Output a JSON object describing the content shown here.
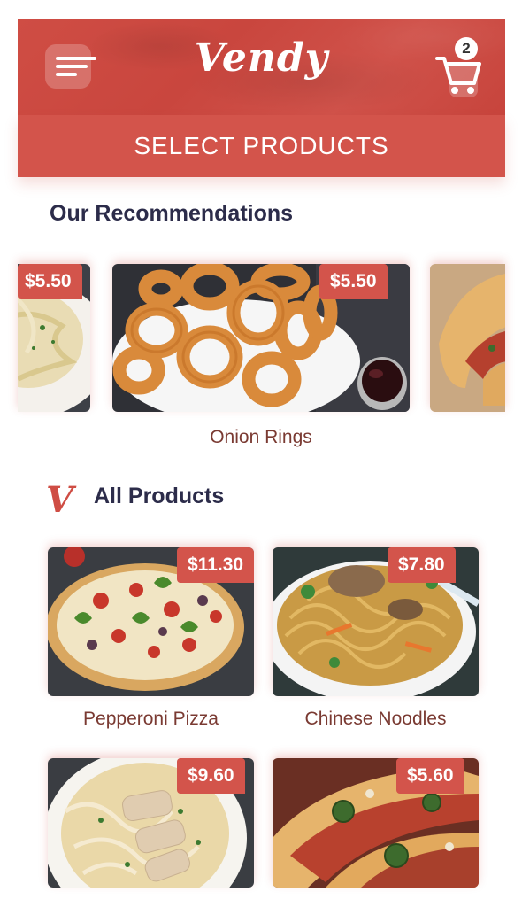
{
  "header": {
    "logo": "Vendy",
    "cart_count": "2",
    "subtitle": "SELECT PRODUCTS"
  },
  "recommendations": {
    "title": "Our Recommendations",
    "items": [
      {
        "name": "",
        "price": "$5.50"
      },
      {
        "name": "Onion Rings",
        "price": "$5.50"
      },
      {
        "name": "",
        "price": ""
      }
    ]
  },
  "all_products": {
    "icon_letter": "V",
    "title": "All Products",
    "items": [
      {
        "name": "Pepperoni Pizza",
        "price": "$11.30"
      },
      {
        "name": "Chinese Noodles",
        "price": "$7.80"
      },
      {
        "name": "",
        "price": "$9.60"
      },
      {
        "name": "",
        "price": "$5.60"
      }
    ]
  },
  "colors": {
    "brand": "#cf4d44",
    "title_text": "#2c2c4a",
    "label_text": "#7a3a32"
  }
}
